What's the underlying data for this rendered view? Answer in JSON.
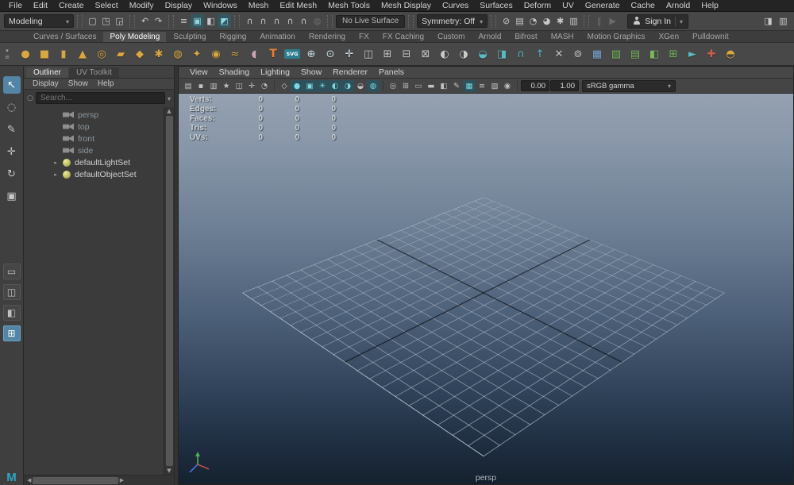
{
  "colors": {
    "active_tool_blue": "#5285a6",
    "viewport_gradient_top": "#95a1b1",
    "viewport_gradient_bottom": "#15212e",
    "shelf_primitive_gold": "#d9a640"
  },
  "menu_bar": {
    "items": [
      "File",
      "Edit",
      "Create",
      "Select",
      "Modify",
      "Display",
      "Windows",
      "Mesh",
      "Edit Mesh",
      "Mesh Tools",
      "Mesh Display",
      "Curves",
      "Surfaces",
      "Deform",
      "UV",
      "Generate",
      "Cache",
      "Arnold",
      "Help"
    ]
  },
  "status_line": {
    "menu_set": "Modeling",
    "file_icons": [
      {
        "name": "new-scene-icon",
        "glyph": "▢",
        "state": ""
      },
      {
        "name": "open-scene-icon",
        "glyph": "◳",
        "state": ""
      },
      {
        "name": "save-scene-icon",
        "glyph": "◲",
        "state": ""
      }
    ],
    "history_icons": [
      {
        "name": "undo-icon",
        "glyph": "↶",
        "state": ""
      },
      {
        "name": "redo-icon",
        "glyph": "↷",
        "state": ""
      }
    ],
    "selection_icons": [
      {
        "name": "select-by-hierarchy-icon",
        "glyph": "≡",
        "state": ""
      },
      {
        "name": "select-by-object-icon",
        "glyph": "▣",
        "state": "on"
      },
      {
        "name": "select-by-component-icon",
        "glyph": "◧",
        "state": ""
      },
      {
        "name": "highlight-selection-mode-icon",
        "glyph": "◩",
        "state": "on"
      }
    ],
    "snap_icons": [
      {
        "name": "snap-to-grid-icon",
        "glyph": "∩",
        "state": ""
      },
      {
        "name": "snap-to-curve-icon",
        "glyph": "∩",
        "state": ""
      },
      {
        "name": "snap-to-point-icon",
        "glyph": "∩",
        "state": ""
      },
      {
        "name": "snap-to-projected-center-icon",
        "glyph": "∩",
        "state": ""
      },
      {
        "name": "snap-to-view-plane-icon",
        "glyph": "∩",
        "state": ""
      },
      {
        "name": "make-live-icon",
        "glyph": "◍",
        "state": "dim"
      }
    ],
    "live_surface": "No Live Surface",
    "symmetry": "Symmetry: Off",
    "render_icons": [
      {
        "name": "construction-history-icon",
        "glyph": "⊘",
        "state": ""
      },
      {
        "name": "open-render-view-icon",
        "glyph": "▤",
        "state": ""
      },
      {
        "name": "render-current-frame-icon",
        "glyph": "◔",
        "state": ""
      },
      {
        "name": "ipr-render-icon",
        "glyph": "◕",
        "state": ""
      },
      {
        "name": "render-settings-icon",
        "glyph": "✱",
        "state": ""
      },
      {
        "name": "display-layer-editor-icon",
        "glyph": "▥",
        "state": ""
      }
    ],
    "playback_icons": [
      {
        "name": "pause-icon",
        "glyph": "‖",
        "state": "dim"
      },
      {
        "name": "play-icon",
        "glyph": "▶",
        "state": "dim"
      }
    ],
    "sign_in_label": "Sign In",
    "right_icons": [
      {
        "name": "attribute-editor-toggle-icon",
        "glyph": "◨",
        "state": ""
      },
      {
        "name": "channel-box-toggle-icon",
        "glyph": "▥",
        "state": ""
      }
    ]
  },
  "shelf": {
    "side_icons": [
      {
        "name": "shelf-tab-options-icon",
        "glyph": "▾"
      },
      {
        "name": "shelf-menu-icon",
        "glyph": "≡"
      }
    ],
    "tabs": [
      {
        "label": "Curves / Surfaces",
        "state": ""
      },
      {
        "label": "Poly Modeling",
        "state": "active"
      },
      {
        "label": "Sculpting",
        "state": ""
      },
      {
        "label": "Rigging",
        "state": ""
      },
      {
        "label": "Animation",
        "state": ""
      },
      {
        "label": "Rendering",
        "state": ""
      },
      {
        "label": "FX",
        "state": ""
      },
      {
        "label": "FX Caching",
        "state": ""
      },
      {
        "label": "Custom",
        "state": ""
      },
      {
        "label": "Arnold",
        "state": ""
      },
      {
        "label": "Bifrost",
        "state": ""
      },
      {
        "label": "MASH",
        "state": ""
      },
      {
        "label": "Motion Graphics",
        "state": ""
      },
      {
        "label": "XGen",
        "state": ""
      },
      {
        "label": "Pulldownit",
        "state": ""
      }
    ],
    "icons": [
      {
        "name": "poly-sphere-icon",
        "glyph": "●",
        "color": "#d9a640",
        "state": ""
      },
      {
        "name": "poly-cube-icon",
        "glyph": "■",
        "color": "#d9a640",
        "state": ""
      },
      {
        "name": "poly-cylinder-icon",
        "glyph": "▮",
        "color": "#d9a640",
        "state": ""
      },
      {
        "name": "poly-cone-icon",
        "glyph": "▲",
        "color": "#d9a640",
        "state": ""
      },
      {
        "name": "poly-torus-icon",
        "glyph": "◎",
        "color": "#d9a640",
        "state": ""
      },
      {
        "name": "poly-plane-icon",
        "glyph": "▰",
        "color": "#d9a640",
        "state": ""
      },
      {
        "name": "poly-disc-icon",
        "glyph": "◆",
        "color": "#d9a640",
        "state": ""
      },
      {
        "name": "poly-gear-icon",
        "glyph": "✱",
        "color": "#d9a640",
        "state": ""
      },
      {
        "name": "poly-soccer-ball-icon",
        "glyph": "◍",
        "color": "#d9a640",
        "state": ""
      },
      {
        "name": "platonic-solid-icon",
        "glyph": "✦",
        "color": "#d9a640",
        "state": ""
      },
      {
        "name": "poly-pipe-icon",
        "glyph": "◉",
        "color": "#d9a640",
        "state": ""
      },
      {
        "name": "poly-helix-icon",
        "glyph": "≈",
        "color": "#d9a640",
        "state": ""
      },
      {
        "name": "super-ellipse-icon",
        "glyph": "◖",
        "color": "#c9a0b4",
        "state": ""
      },
      {
        "name": "type-tool-icon",
        "glyph": "T",
        "color": "#e0823a",
        "state": "type"
      },
      {
        "name": "svg-tool-icon",
        "glyph": "SVG",
        "color": "#ffffff",
        "state": "badge"
      },
      {
        "name": "center-pivot-icon",
        "glyph": "⊕",
        "color": "#cfe3ea",
        "state": ""
      },
      {
        "name": "snap-together-tool-icon",
        "glyph": "⊙",
        "color": "#cfe3ea",
        "state": ""
      },
      {
        "name": "align-objects-icon",
        "glyph": "✛",
        "color": "#cfe3ea",
        "state": ""
      },
      {
        "name": "mirror-icon",
        "glyph": "◫",
        "color": "#c9c9c9",
        "state": ""
      },
      {
        "name": "combine-icon",
        "glyph": "⊞",
        "color": "#c9c9c9",
        "state": ""
      },
      {
        "name": "separate-icon",
        "glyph": "⊟",
        "state": "",
        "color": "#c9c9c9"
      },
      {
        "name": "extract-icon",
        "glyph": "⊠",
        "color": "#c9c9c9",
        "state": ""
      },
      {
        "name": "boolean-union-icon",
        "glyph": "◐",
        "color": "#c9c9c9",
        "state": ""
      },
      {
        "name": "boolean-difference-icon",
        "glyph": "◑",
        "color": "#c9c9c9",
        "state": ""
      },
      {
        "name": "smooth-icon",
        "glyph": "◒",
        "color": "#5bb8c4",
        "state": ""
      },
      {
        "name": "bevel-icon",
        "glyph": "◨",
        "color": "#5bb8c4",
        "state": ""
      },
      {
        "name": "bridge-icon",
        "glyph": "∩",
        "color": "#5bb8c4",
        "state": ""
      },
      {
        "name": "extrude-icon",
        "glyph": "↑",
        "color": "#5bb8c4",
        "state": ""
      },
      {
        "name": "multi-cut-icon",
        "glyph": "✕",
        "color": "#c9c9c9",
        "state": ""
      },
      {
        "name": "target-weld-icon",
        "glyph": "⊚",
        "color": "#c9c9c9",
        "state": ""
      },
      {
        "name": "quad-draw-icon",
        "glyph": "▦",
        "color": "#7aa7d6",
        "state": ""
      },
      {
        "name": "uv-editor-icon",
        "glyph": "▧",
        "color": "#79b95c",
        "state": ""
      },
      {
        "name": "uv-layout-icon",
        "glyph": "▤",
        "color": "#79b95c",
        "state": ""
      },
      {
        "name": "uv-unfold-icon",
        "glyph": "◧",
        "color": "#79b95c",
        "state": ""
      },
      {
        "name": "uv-cut-sew-icon",
        "glyph": "⊞",
        "color": "#79b95c",
        "state": ""
      },
      {
        "name": "transfer-attributes-icon",
        "glyph": "►",
        "color": "#5bb8c4",
        "state": ""
      },
      {
        "name": "reduce-icon",
        "glyph": "✚",
        "color": "#cf5b4e",
        "state": ""
      },
      {
        "name": "sculpt-mesh-icon",
        "glyph": "◓",
        "color": "#d9a640",
        "state": ""
      }
    ]
  },
  "toolbox": {
    "tools": [
      {
        "name": "select-tool",
        "glyph": "↖",
        "state": "active"
      },
      {
        "name": "lasso-select-tool",
        "glyph": "◌",
        "state": ""
      },
      {
        "name": "paint-select-tool",
        "glyph": "✎",
        "state": ""
      },
      {
        "name": "move-tool",
        "glyph": "✛",
        "state": ""
      },
      {
        "name": "rotate-tool",
        "glyph": "↻",
        "state": ""
      },
      {
        "name": "scale-tool",
        "glyph": "▣",
        "state": ""
      }
    ],
    "layouts": [
      {
        "name": "layout-single-pane-button",
        "glyph": "▭",
        "state": ""
      },
      {
        "name": "layout-two-pane-button",
        "glyph": "◫",
        "state": ""
      },
      {
        "name": "layout-persp-outliner-button",
        "glyph": "◧",
        "state": ""
      },
      {
        "name": "layout-four-pane-button",
        "glyph": "⊞",
        "state": "active"
      }
    ],
    "logo": "M"
  },
  "outliner": {
    "tabs": [
      {
        "label": "Outliner",
        "state": "active"
      },
      {
        "label": "UV Toolkit",
        "state": ""
      }
    ],
    "menu": [
      "Display",
      "Show",
      "Help"
    ],
    "search_placeholder": "Search...",
    "items": [
      {
        "name": "outliner-item-persp",
        "label": "persp",
        "type": "cam",
        "dim": "dim",
        "tw": ""
      },
      {
        "name": "outliner-item-top",
        "label": "top",
        "type": "cam",
        "dim": "dim",
        "tw": ""
      },
      {
        "name": "outliner-item-front",
        "label": "front",
        "type": "cam",
        "dim": "dim",
        "tw": ""
      },
      {
        "name": "outliner-item-side",
        "label": "side",
        "type": "cam",
        "dim": "dim",
        "tw": ""
      },
      {
        "name": "outliner-item-defaultLightSet",
        "label": "defaultLightSet",
        "type": "set",
        "dim": "",
        "tw": "▸"
      },
      {
        "name": "outliner-item-defaultObjectSet",
        "label": "defaultObjectSet",
        "type": "set",
        "dim": "",
        "tw": "▸"
      }
    ]
  },
  "viewport": {
    "menu": [
      "View",
      "Shading",
      "Lighting",
      "Show",
      "Renderer",
      "Panels"
    ],
    "toolbar": {
      "camera_icons": [
        {
          "name": "select-camera-icon",
          "glyph": "▤",
          "state": ""
        },
        {
          "name": "lock-camera-icon",
          "glyph": "▪",
          "state": ""
        },
        {
          "name": "camera-attributes-icon",
          "glyph": "▥",
          "state": ""
        },
        {
          "name": "bookmarks-icon",
          "glyph": "★",
          "state": ""
        },
        {
          "name": "image-plane-icon",
          "glyph": "◫",
          "state": ""
        },
        {
          "name": "two-d-pan-zoom-icon",
          "glyph": "✛",
          "state": ""
        },
        {
          "name": "oversampling-icon",
          "glyph": "◔",
          "state": ""
        }
      ],
      "shading_icons": [
        {
          "name": "wireframe-icon",
          "glyph": "◇",
          "state": ""
        },
        {
          "name": "smooth-shade-icon",
          "glyph": "●",
          "state": "on"
        },
        {
          "name": "textured-icon",
          "glyph": "▣",
          "state": "on"
        },
        {
          "name": "lights-icon",
          "glyph": "☀",
          "state": "on"
        },
        {
          "name": "shadows-icon",
          "glyph": "◐",
          "state": "on"
        },
        {
          "name": "ambient-occlusion-icon",
          "glyph": "◑",
          "state": "on"
        },
        {
          "name": "motion-blur-icon",
          "glyph": "◒",
          "state": ""
        },
        {
          "name": "multisample-icon",
          "glyph": "◍",
          "state": "on"
        }
      ],
      "display_icons": [
        {
          "name": "isolate-select-icon",
          "glyph": "◎",
          "state": ""
        },
        {
          "name": "field-chart-icon",
          "glyph": "⊞",
          "state": ""
        },
        {
          "name": "resolution-gate-icon",
          "glyph": "▭",
          "state": ""
        },
        {
          "name": "film-gate-icon",
          "glyph": "▬",
          "state": ""
        },
        {
          "name": "display-mask-icon",
          "glyph": "◧",
          "state": ""
        },
        {
          "name": "grease-pencil-icon",
          "glyph": "✎",
          "state": ""
        },
        {
          "name": "grid-toggle-icon",
          "glyph": "▦",
          "state": "on"
        },
        {
          "name": "hud-toggle-icon",
          "glyph": "≡",
          "state": ""
        },
        {
          "name": "xray-icon",
          "glyph": "▨",
          "state": ""
        },
        {
          "name": "snapshot-icon",
          "glyph": "◉",
          "state": ""
        }
      ],
      "exposure": "0.00",
      "gamma": "1.00",
      "color_space": "sRGB gamma"
    },
    "hud": {
      "rows": [
        {
          "label": "Verts:",
          "v0": "0",
          "v1": "0",
          "v2": "0"
        },
        {
          "label": "Edges:",
          "v0": "0",
          "v1": "0",
          "v2": "0"
        },
        {
          "label": "Faces:",
          "v0": "0",
          "v1": "0",
          "v2": "0"
        },
        {
          "label": "Tris:",
          "v0": "0",
          "v1": "0",
          "v2": "0"
        },
        {
          "label": "UVs:",
          "v0": "0",
          "v1": "0",
          "v2": "0"
        }
      ]
    },
    "camera_label": "persp"
  }
}
